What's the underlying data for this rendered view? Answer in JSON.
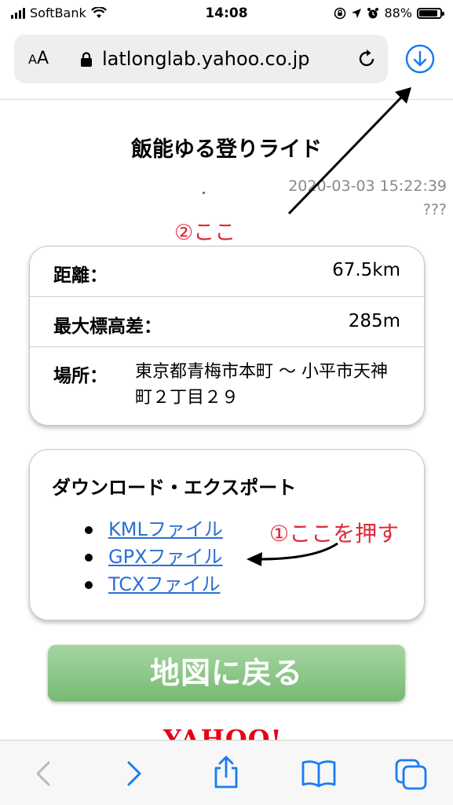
{
  "status_bar": {
    "carrier": "SoftBank",
    "time": "14:08",
    "battery_percent": "88%",
    "battery_level": 0.88
  },
  "browser": {
    "text_size_label_small": "A",
    "text_size_label_large": "A",
    "url": "latlonglab.yahoo.co.jp"
  },
  "page": {
    "title": "飯能ゆる登りライド",
    "datetime": "2020-03-03 15:22:39",
    "author": "???",
    "info": {
      "distance_label": "距離：",
      "distance_value": "67.5km",
      "elevation_label": "最大標高差：",
      "elevation_value": "285m",
      "place_label": "場所：",
      "place_value": "東京都青梅市本町 〜 小平市天神町２丁目２９"
    },
    "download": {
      "heading": "ダウンロード・エクスポート",
      "links": [
        "KMLファイル",
        "GPXファイル",
        "TCXファイル"
      ]
    },
    "back_button": "地図に戻る",
    "footer_logo": "YAHOO!"
  },
  "annotations": {
    "step1": "①ここを押す",
    "step2": "②ここ",
    "color": "#e0283a"
  },
  "toolbar": {
    "icons": [
      "back-icon",
      "forward-icon",
      "share-icon",
      "bookmarks-icon",
      "tabs-icon"
    ]
  },
  "colors": {
    "link": "#2b6fd1",
    "accent": "#1a7cf0",
    "button_green": "#8cc788"
  }
}
